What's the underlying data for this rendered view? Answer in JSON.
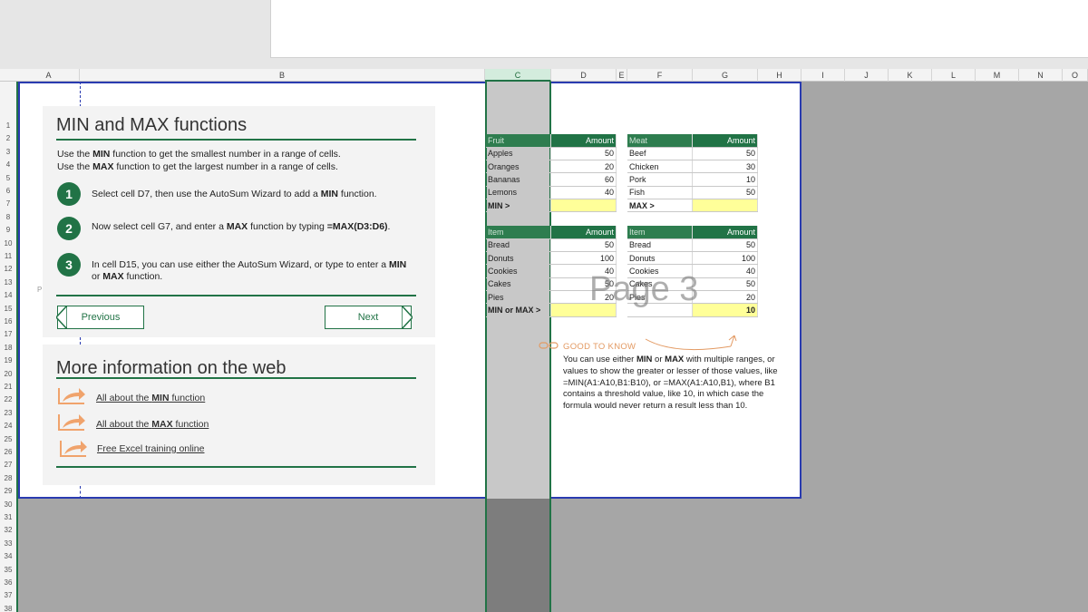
{
  "columns": [
    "A",
    "B",
    "C",
    "D",
    "E",
    "F",
    "G",
    "H",
    "I",
    "J",
    "K",
    "L",
    "M",
    "N",
    "O"
  ],
  "rows": [
    "1",
    "2",
    "3",
    "4",
    "5",
    "6",
    "7",
    "8",
    "9",
    "10",
    "11",
    "12",
    "13",
    "14",
    "15",
    "16",
    "17",
    "18",
    "19",
    "20",
    "21",
    "22",
    "23",
    "24",
    "25",
    "26",
    "27",
    "28",
    "29",
    "30",
    "31",
    "32",
    "33",
    "34",
    "35",
    "36",
    "37",
    "38"
  ],
  "selected_column": "C",
  "panel1": {
    "title": "MIN and MAX functions",
    "intro1": {
      "a": "Use the ",
      "b": "MIN",
      "c": " function to get the smallest number in a range of cells."
    },
    "intro2": {
      "a": "Use the ",
      "b": "MAX",
      "c": " function to get the largest number in a range of cells."
    },
    "steps": [
      {
        "num": "1",
        "a": "Select cell D7, then use the AutoSum Wizard to add a ",
        "b": "MIN",
        "c": " function."
      },
      {
        "num": "2",
        "a": "Now select cell G7, and enter a ",
        "b": "MAX",
        "c": " function by typing ",
        "d": "=MAX(D3:D6)",
        "e": "."
      },
      {
        "num": "3",
        "a": "In cell D15, you can use either the AutoSum Wizard, or type to enter a ",
        "b": "MIN",
        "c": "or ",
        "d": "MAX",
        "e": " function."
      }
    ],
    "prev_label": "Previous",
    "next_label": "Next"
  },
  "panel2": {
    "title": "More information on the web",
    "links": [
      {
        "a": "All about the ",
        "b": "MIN",
        "c": " function"
      },
      {
        "a": "All about the ",
        "b": "MAX",
        "c": " function"
      },
      {
        "a": "Free Excel training online",
        "b": "",
        "c": ""
      }
    ]
  },
  "stray_p": "P",
  "tables": {
    "fruit": {
      "label": "Fruit",
      "amount": "Amount",
      "rows": [
        [
          "Apples",
          "50"
        ],
        [
          "Oranges",
          "20"
        ],
        [
          "Bananas",
          "60"
        ],
        [
          "Lemons",
          "40"
        ]
      ],
      "total": "MIN >",
      "result": ""
    },
    "meat": {
      "label": "Meat",
      "amount": "Amount",
      "rows": [
        [
          "Beef",
          "50"
        ],
        [
          "Chicken",
          "30"
        ],
        [
          "Pork",
          "10"
        ],
        [
          "Fish",
          "50"
        ]
      ],
      "total": "MAX >",
      "result": ""
    },
    "item1": {
      "label": "Item",
      "amount": "Amount",
      "rows": [
        [
          "Bread",
          "50"
        ],
        [
          "Donuts",
          "100"
        ],
        [
          "Cookies",
          "40"
        ],
        [
          "Cakes",
          "50"
        ],
        [
          "Pies",
          "20"
        ]
      ],
      "total": "MIN or MAX >",
      "result": ""
    },
    "item2": {
      "label": "Item",
      "amount": "Amount",
      "rows": [
        [
          "Bread",
          "50"
        ],
        [
          "Donuts",
          "100"
        ],
        [
          "Cookies",
          "40"
        ],
        [
          "Cakes",
          "50"
        ],
        [
          "Pies",
          "20"
        ]
      ],
      "total": "",
      "result": "10"
    }
  },
  "watermark": "Page 3",
  "good_to_know": {
    "label": "GOOD TO KNOW",
    "t1": "You can use either ",
    "b1": "MIN",
    "t2": " or ",
    "b2": "MAX",
    "t3": " with multiple ranges, or values to show the greater or lesser of those values, like =MIN(A1:A10,B1:B10), or =MAX(A1:A10,B1), where B1 contains a threshold value, like 10, in which case the formula would never return a result less than 10."
  },
  "colors": {
    "accent": "#217346",
    "page_border": "#2a3bb0",
    "highlight": "#ffff99",
    "tip": "#e39a63"
  }
}
